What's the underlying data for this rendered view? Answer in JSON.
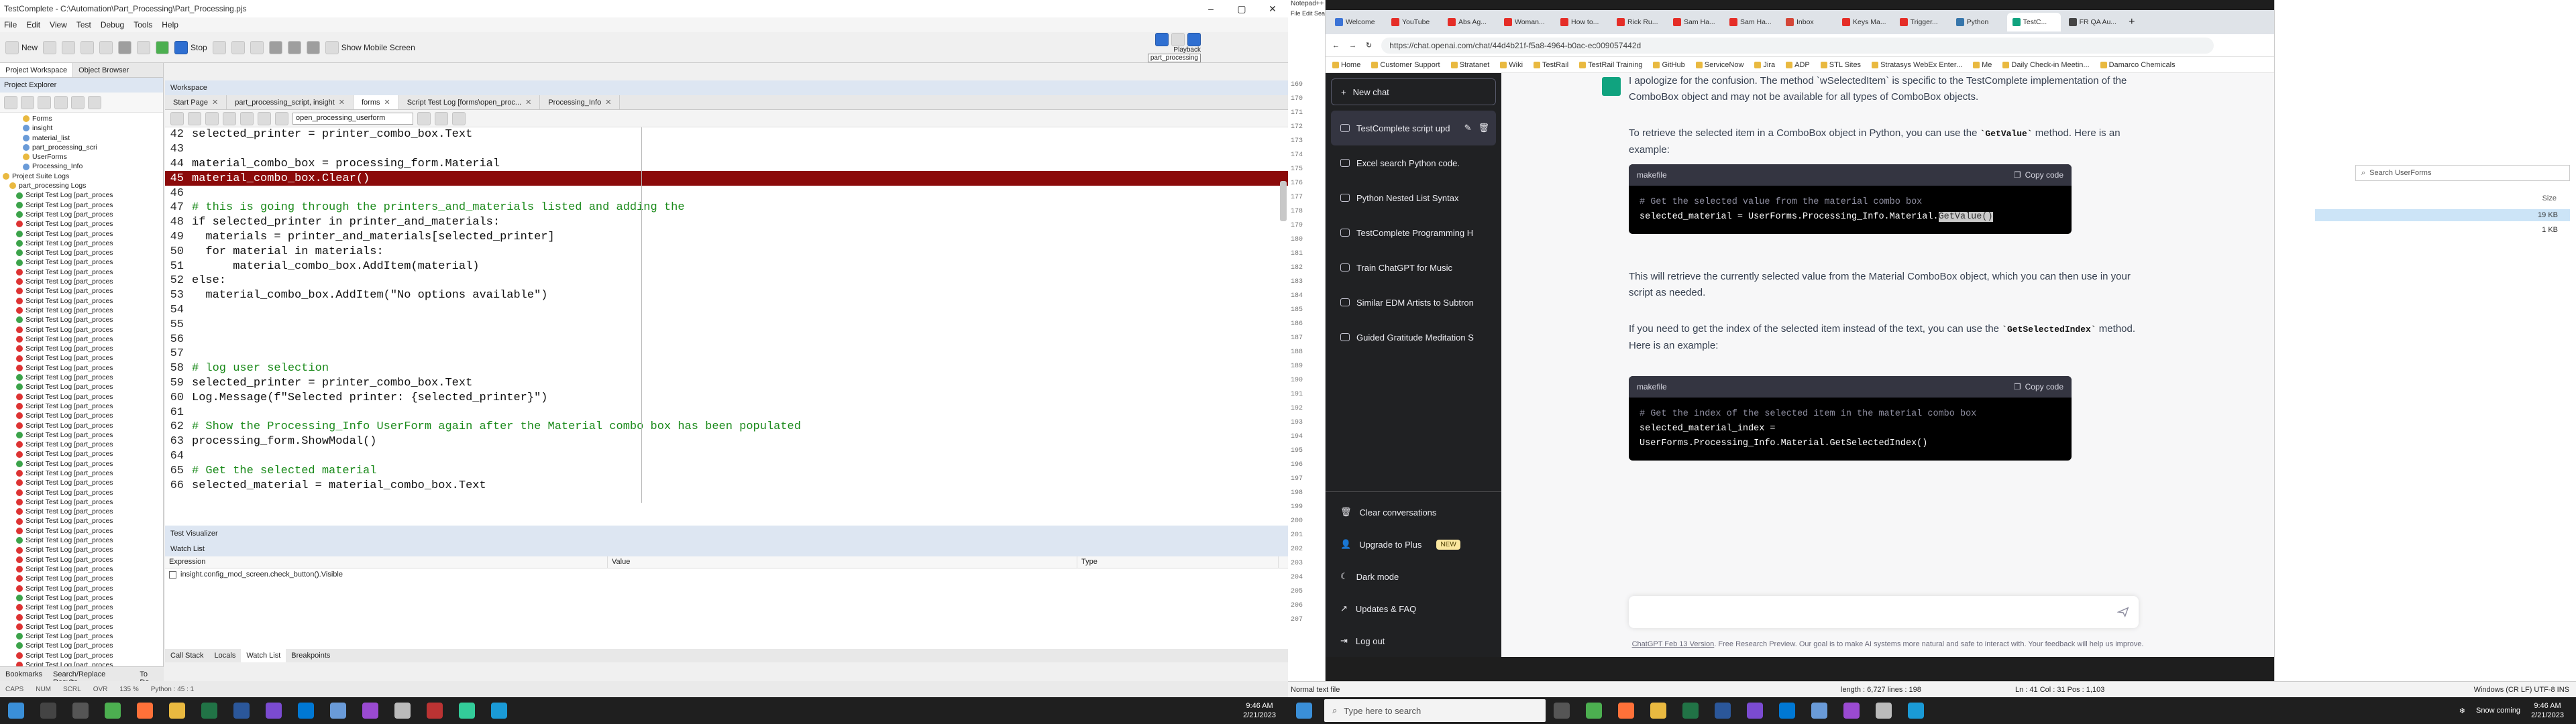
{
  "tc": {
    "title": "TestComplete - C:\\Automation\\Part_Processing\\Part_Processing.pjs",
    "menu": [
      "File",
      "Edit",
      "View",
      "Test",
      "Debug",
      "Tools",
      "Help"
    ],
    "toolbar": {
      "new_label": "New",
      "stop_label": "Stop",
      "mobile_label": "Show Mobile Screen",
      "playback_label": "Playback",
      "playback_tooltip": "part_processing"
    },
    "left_tabs": [
      "Project Workspace",
      "Object Browser"
    ],
    "left_header": "Project Explorer",
    "tree_top": [
      {
        "label": "Forms",
        "icon": "folder"
      },
      {
        "label": "insight",
        "icon": "file"
      },
      {
        "label": "material_list",
        "icon": "file"
      },
      {
        "label": "part_processing_scri",
        "icon": "file"
      },
      {
        "label": "UserForms",
        "icon": "folder"
      },
      {
        "label": "Processing_Info",
        "icon": "file"
      },
      {
        "label": "Project Suite Logs",
        "icon": "folder"
      },
      {
        "label": "part_processing Logs",
        "icon": "folder"
      }
    ],
    "log_item_label": "Script Test Log [part_proces",
    "log_items": [
      "g",
      "g",
      "g",
      "r",
      "g",
      "g",
      "g",
      "g",
      "r",
      "r",
      "r",
      "r",
      "r",
      "g",
      "r",
      "r",
      "r",
      "r",
      "r",
      "g",
      "g",
      "r",
      "r",
      "r",
      "r",
      "g",
      "r",
      "r",
      "g",
      "r",
      "r",
      "r",
      "r",
      "r",
      "r",
      "r",
      "g",
      "r",
      "r",
      "r",
      "r",
      "r",
      "g",
      "r",
      "r",
      "r",
      "g",
      "g",
      "r",
      "r",
      "r",
      "r",
      "r",
      "r",
      "r",
      "r",
      "r",
      "r"
    ],
    "bottom_tabs": [
      "Bookmarks",
      "Search/Replace Results",
      "To Do"
    ],
    "workspace_header": "Workspace",
    "doc_tabs": [
      "Start Page",
      "part_processing_script, insight",
      "forms",
      "Script Test Log [forms\\open_proc...",
      "Processing_Info"
    ],
    "editor_combo": "open_processing_userform",
    "code_lines": [
      {
        "n": "42",
        "t": "selected_printer = printer_combo_box.Text",
        "c": "txt"
      },
      {
        "n": "43",
        "t": "",
        "c": "txt"
      },
      {
        "n": "44",
        "t": "material_combo_box = processing_form.Material",
        "c": "txt"
      },
      {
        "n": "45",
        "t": "material_combo_box.Clear()",
        "c": "err"
      },
      {
        "n": "46",
        "t": "",
        "c": "txt"
      },
      {
        "n": "47",
        "t": "# this is going through the printers_and_materials listed and adding the",
        "c": "cmt"
      },
      {
        "n": "48",
        "t": "if selected_printer in printer_and_materials:",
        "c": "txt"
      },
      {
        "n": "49",
        "t": "  materials = printer_and_materials[selected_printer]",
        "c": "txt"
      },
      {
        "n": "50",
        "t": "  for material in materials:",
        "c": "txt"
      },
      {
        "n": "51",
        "t": "      material_combo_box.AddItem(material)",
        "c": "txt"
      },
      {
        "n": "52",
        "t": "else:",
        "c": "txt"
      },
      {
        "n": "53",
        "t": "  material_combo_box.AddItem(\"No options available\")",
        "c": "txt"
      },
      {
        "n": "54",
        "t": "",
        "c": "txt"
      },
      {
        "n": "55",
        "t": "",
        "c": "txt"
      },
      {
        "n": "56",
        "t": "",
        "c": "txt"
      },
      {
        "n": "57",
        "t": "",
        "c": "txt"
      },
      {
        "n": "58",
        "t": "# log user selection",
        "c": "cmt"
      },
      {
        "n": "59",
        "t": "selected_printer = printer_combo_box.Text",
        "c": "txt"
      },
      {
        "n": "60",
        "t": "Log.Message(f\"Selected printer: {selected_printer}\")",
        "c": "txt"
      },
      {
        "n": "61",
        "t": "",
        "c": "txt"
      },
      {
        "n": "62",
        "t": "# Show the Processing_Info UserForm again after the Material combo box has been populated",
        "c": "cmt"
      },
      {
        "n": "63",
        "t": "processing_form.ShowModal()",
        "c": "txt"
      },
      {
        "n": "64",
        "t": "",
        "c": "txt"
      },
      {
        "n": "65",
        "t": "# Get the selected material",
        "c": "cmt"
      },
      {
        "n": "66",
        "t": "selected_material = material_combo_box.Text",
        "c": "txt"
      }
    ],
    "visualizer_label": "Test Visualizer",
    "watch_header": "Watch List",
    "watch_cols": [
      "Expression",
      "Value",
      "Type"
    ],
    "watch_row": "insight.config_mod_screen.check_button().Visible",
    "watch_tabs": [
      "Call Stack",
      "Locals",
      "Watch List",
      "Breakpoints"
    ],
    "status": [
      "CAPS",
      "NUM",
      "SCRL",
      "OVR",
      "135 %",
      "Python : 45 : 1"
    ]
  },
  "notepad": {
    "title": "Notepad++",
    "menu": "File Edit Search View",
    "lines": [
      "169",
      "170",
      "171",
      "172",
      "173",
      "174",
      "175",
      "176",
      "177",
      "178",
      "179",
      "180",
      "181",
      "182",
      "183",
      "184",
      "185",
      "186",
      "187",
      "188",
      "189",
      "190",
      "191",
      "192",
      "193",
      "194",
      "195",
      "196",
      "197",
      "198",
      "199",
      "200",
      "201",
      "202",
      "203",
      "204",
      "205",
      "206",
      "207"
    ],
    "status_left": "Normal text file",
    "status_mid": "length : 6,727   lines : 198",
    "status_pos": "Ln : 41   Col : 31   Pos : 1,103",
    "status_right": "Windows (CR LF)   UTF-8   INS"
  },
  "browser": {
    "tabs": [
      {
        "label": "Welcome",
        "color": "#3b73d6"
      },
      {
        "label": "YouTube",
        "color": "#e52d27"
      },
      {
        "label": "Abs Ag...",
        "color": "#e52d27"
      },
      {
        "label": "Woman...",
        "color": "#e52d27"
      },
      {
        "label": "How to...",
        "color": "#e52d27"
      },
      {
        "label": "Rick Ru...",
        "color": "#e52d27"
      },
      {
        "label": "Sam Ha...",
        "color": "#e52d27"
      },
      {
        "label": "Sam Ha...",
        "color": "#e52d27"
      },
      {
        "label": "Inbox",
        "color": "#d44638"
      },
      {
        "label": "Keys Ma...",
        "color": "#e52d27"
      },
      {
        "label": "Trigger...",
        "color": "#e52d27"
      },
      {
        "label": "Python",
        "color": "#3776ab"
      },
      {
        "label": "TestC...",
        "color": "#10a37f"
      },
      {
        "label": "FR QA Au...",
        "color": "#444"
      }
    ],
    "url": "https://chat.openai.com/chat/44d4b21f-f5a8-4964-b0ac-ec009057442d",
    "bookmarks": [
      "Home",
      "Customer Support",
      "Stratanet",
      "Wiki",
      "TestRail",
      "TestRail Training",
      "GitHub",
      "ServiceNow",
      "Jira",
      "ADP",
      "STL Sites",
      "Stratasys WebEx Enter...",
      "Me",
      "Daily Check-in Meetin...",
      "Damarco Chemicals"
    ],
    "new_chat": "New chat",
    "conversations": [
      "TestComplete script upd",
      "Excel search Python code.",
      "Python Nested List Syntax",
      "TestComplete Programming H",
      "Train ChatGPT for Music",
      "Similar EDM Artists to Subtron",
      "Guided Gratitude Meditation S"
    ],
    "side_bottom": [
      "Clear conversations",
      "Upgrade to Plus",
      "Dark mode",
      "Updates & FAQ",
      "Log out"
    ],
    "new_badge": "NEW",
    "msg1": "I apologize for the confusion. The method `wSelectedItem` is specific to the TestComplete implementation of the ComboBox object and may not be available for all types of ComboBox objects.",
    "msg2_pre": "To retrieve the selected item in a ComboBox object in Python, you can use the ",
    "msg2_code": "`GetValue`",
    "msg2_post": " method. Here is an example:",
    "code1_lang": "makefile",
    "copy_label": "Copy code",
    "code1_comment": "# Get the selected value from the material combo box",
    "code1_line": "selected_material = UserForms.Processing_Info.Material.",
    "code1_sel": "GetValue()",
    "msg3": "This will retrieve the currently selected value from the Material ComboBox object, which you can then use in your script as needed.",
    "msg4_pre": "If you need to get the index of the selected item instead of the text, you can use the ",
    "msg4_code": "`GetSelectedIndex`",
    "msg4_post": " method. Here is an example:",
    "code2_lang": "makefile",
    "code2_comment": "# Get the index of the selected item in the material combo box",
    "code2_line": "selected_material_index = UserForms.Processing_Info.Material.GetSelectedIndex()",
    "footer_link": "ChatGPT Feb 13 Version",
    "footer_text": ". Free Research Preview. Our goal is to make AI systems more natural and safe to interact with. Your feedback will help us improve."
  },
  "explorer": {
    "search_placeholder": "Search UserForms",
    "col_size": "Size",
    "row1_size": "19 KB",
    "row2_size": "1 KB"
  },
  "taskbar1": {
    "time": "9:46 AM",
    "date": "2/21/2023"
  },
  "taskbar2": {
    "search_placeholder": "Type here to search",
    "weather": "Snow coming",
    "time": "9:46 AM",
    "date": "2/21/2023"
  }
}
